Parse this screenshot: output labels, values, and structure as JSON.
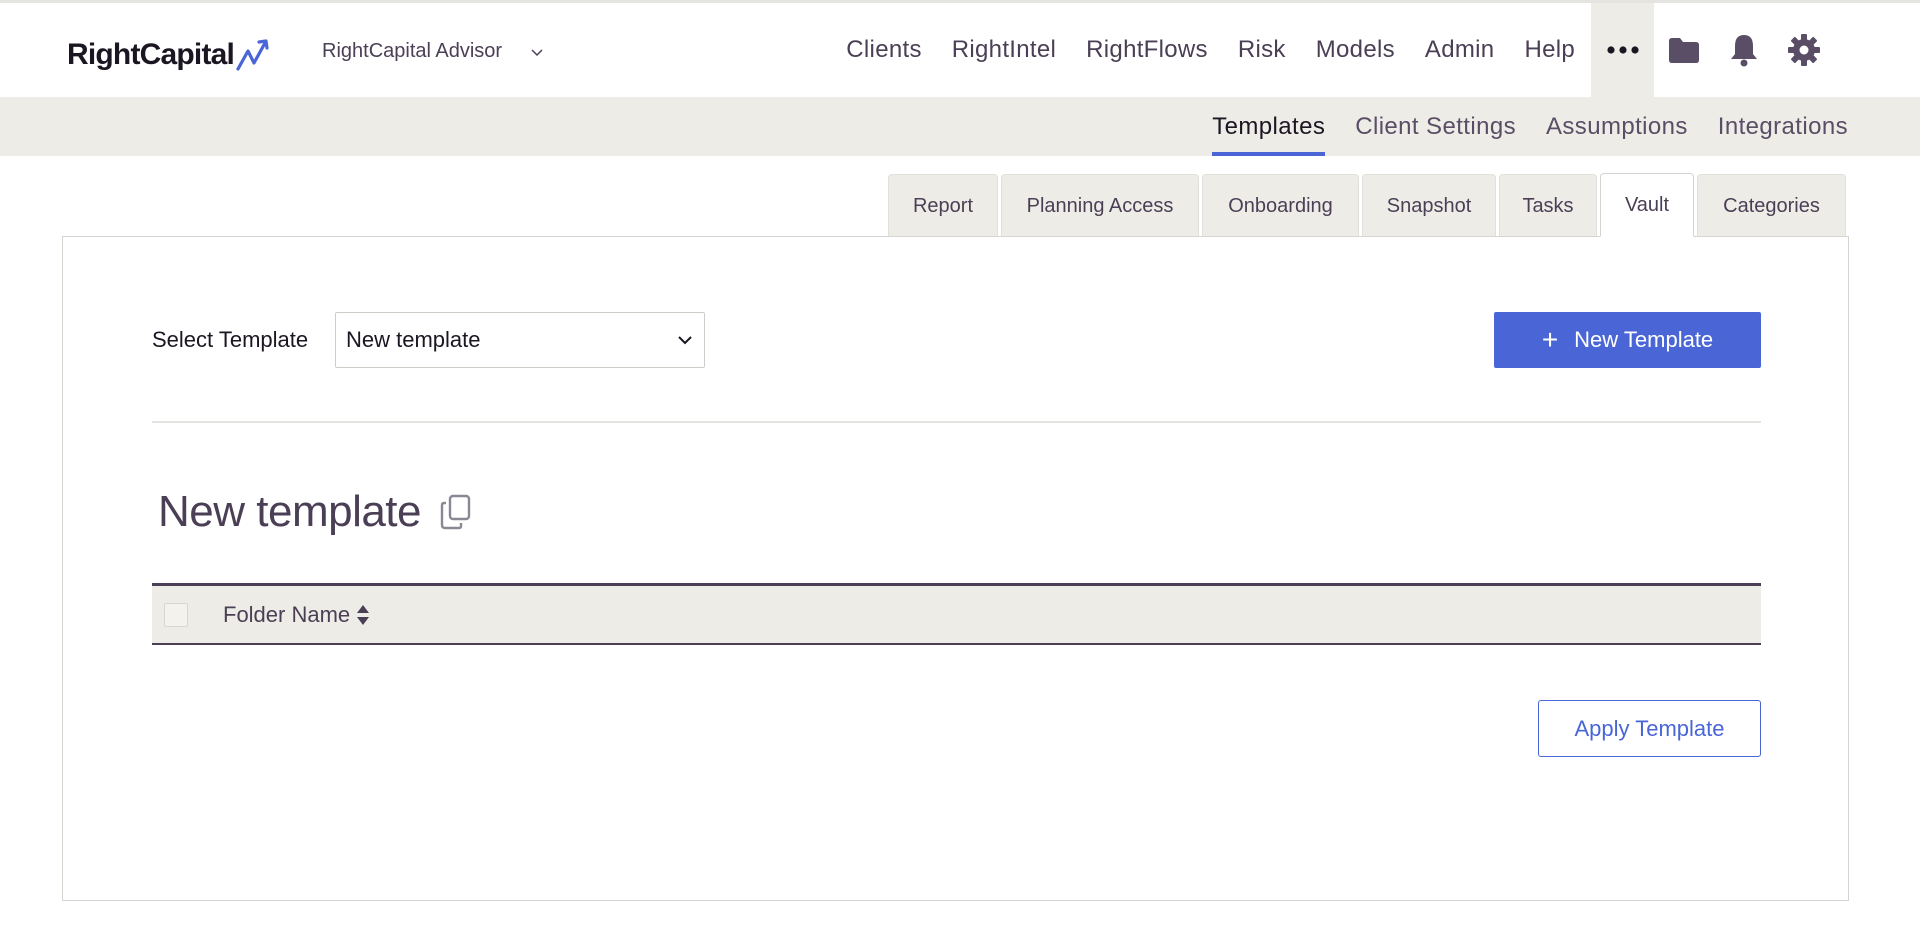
{
  "header": {
    "logo_text": "RightCapital",
    "advisor_name": "RightCapital Advisor",
    "nav": [
      {
        "label": "Clients"
      },
      {
        "label": "RightIntel"
      },
      {
        "label": "RightFlows"
      },
      {
        "label": "Risk"
      },
      {
        "label": "Models"
      },
      {
        "label": "Admin"
      },
      {
        "label": "Help"
      }
    ],
    "icons": [
      "more-icon",
      "folder-icon",
      "bell-icon",
      "gear-icon"
    ]
  },
  "subnav": {
    "items": [
      {
        "label": "Templates",
        "active": true
      },
      {
        "label": "Client Settings"
      },
      {
        "label": "Assumptions"
      },
      {
        "label": "Integrations"
      }
    ]
  },
  "tabs": [
    {
      "label": "Report"
    },
    {
      "label": "Planning Access"
    },
    {
      "label": "Onboarding"
    },
    {
      "label": "Snapshot"
    },
    {
      "label": "Tasks"
    },
    {
      "label": "Vault",
      "active": true
    },
    {
      "label": "Categories"
    }
  ],
  "vault": {
    "select_label": "Select Template",
    "selected_template": "New template",
    "new_template_button": "New Template",
    "template_title": "New template",
    "table": {
      "columns": [
        "Folder Name"
      ],
      "rows": []
    },
    "apply_button": "Apply Template"
  },
  "colors": {
    "accent": "#4a66d6",
    "text": "#4a3f55",
    "subnav_bg": "#eeece7"
  }
}
